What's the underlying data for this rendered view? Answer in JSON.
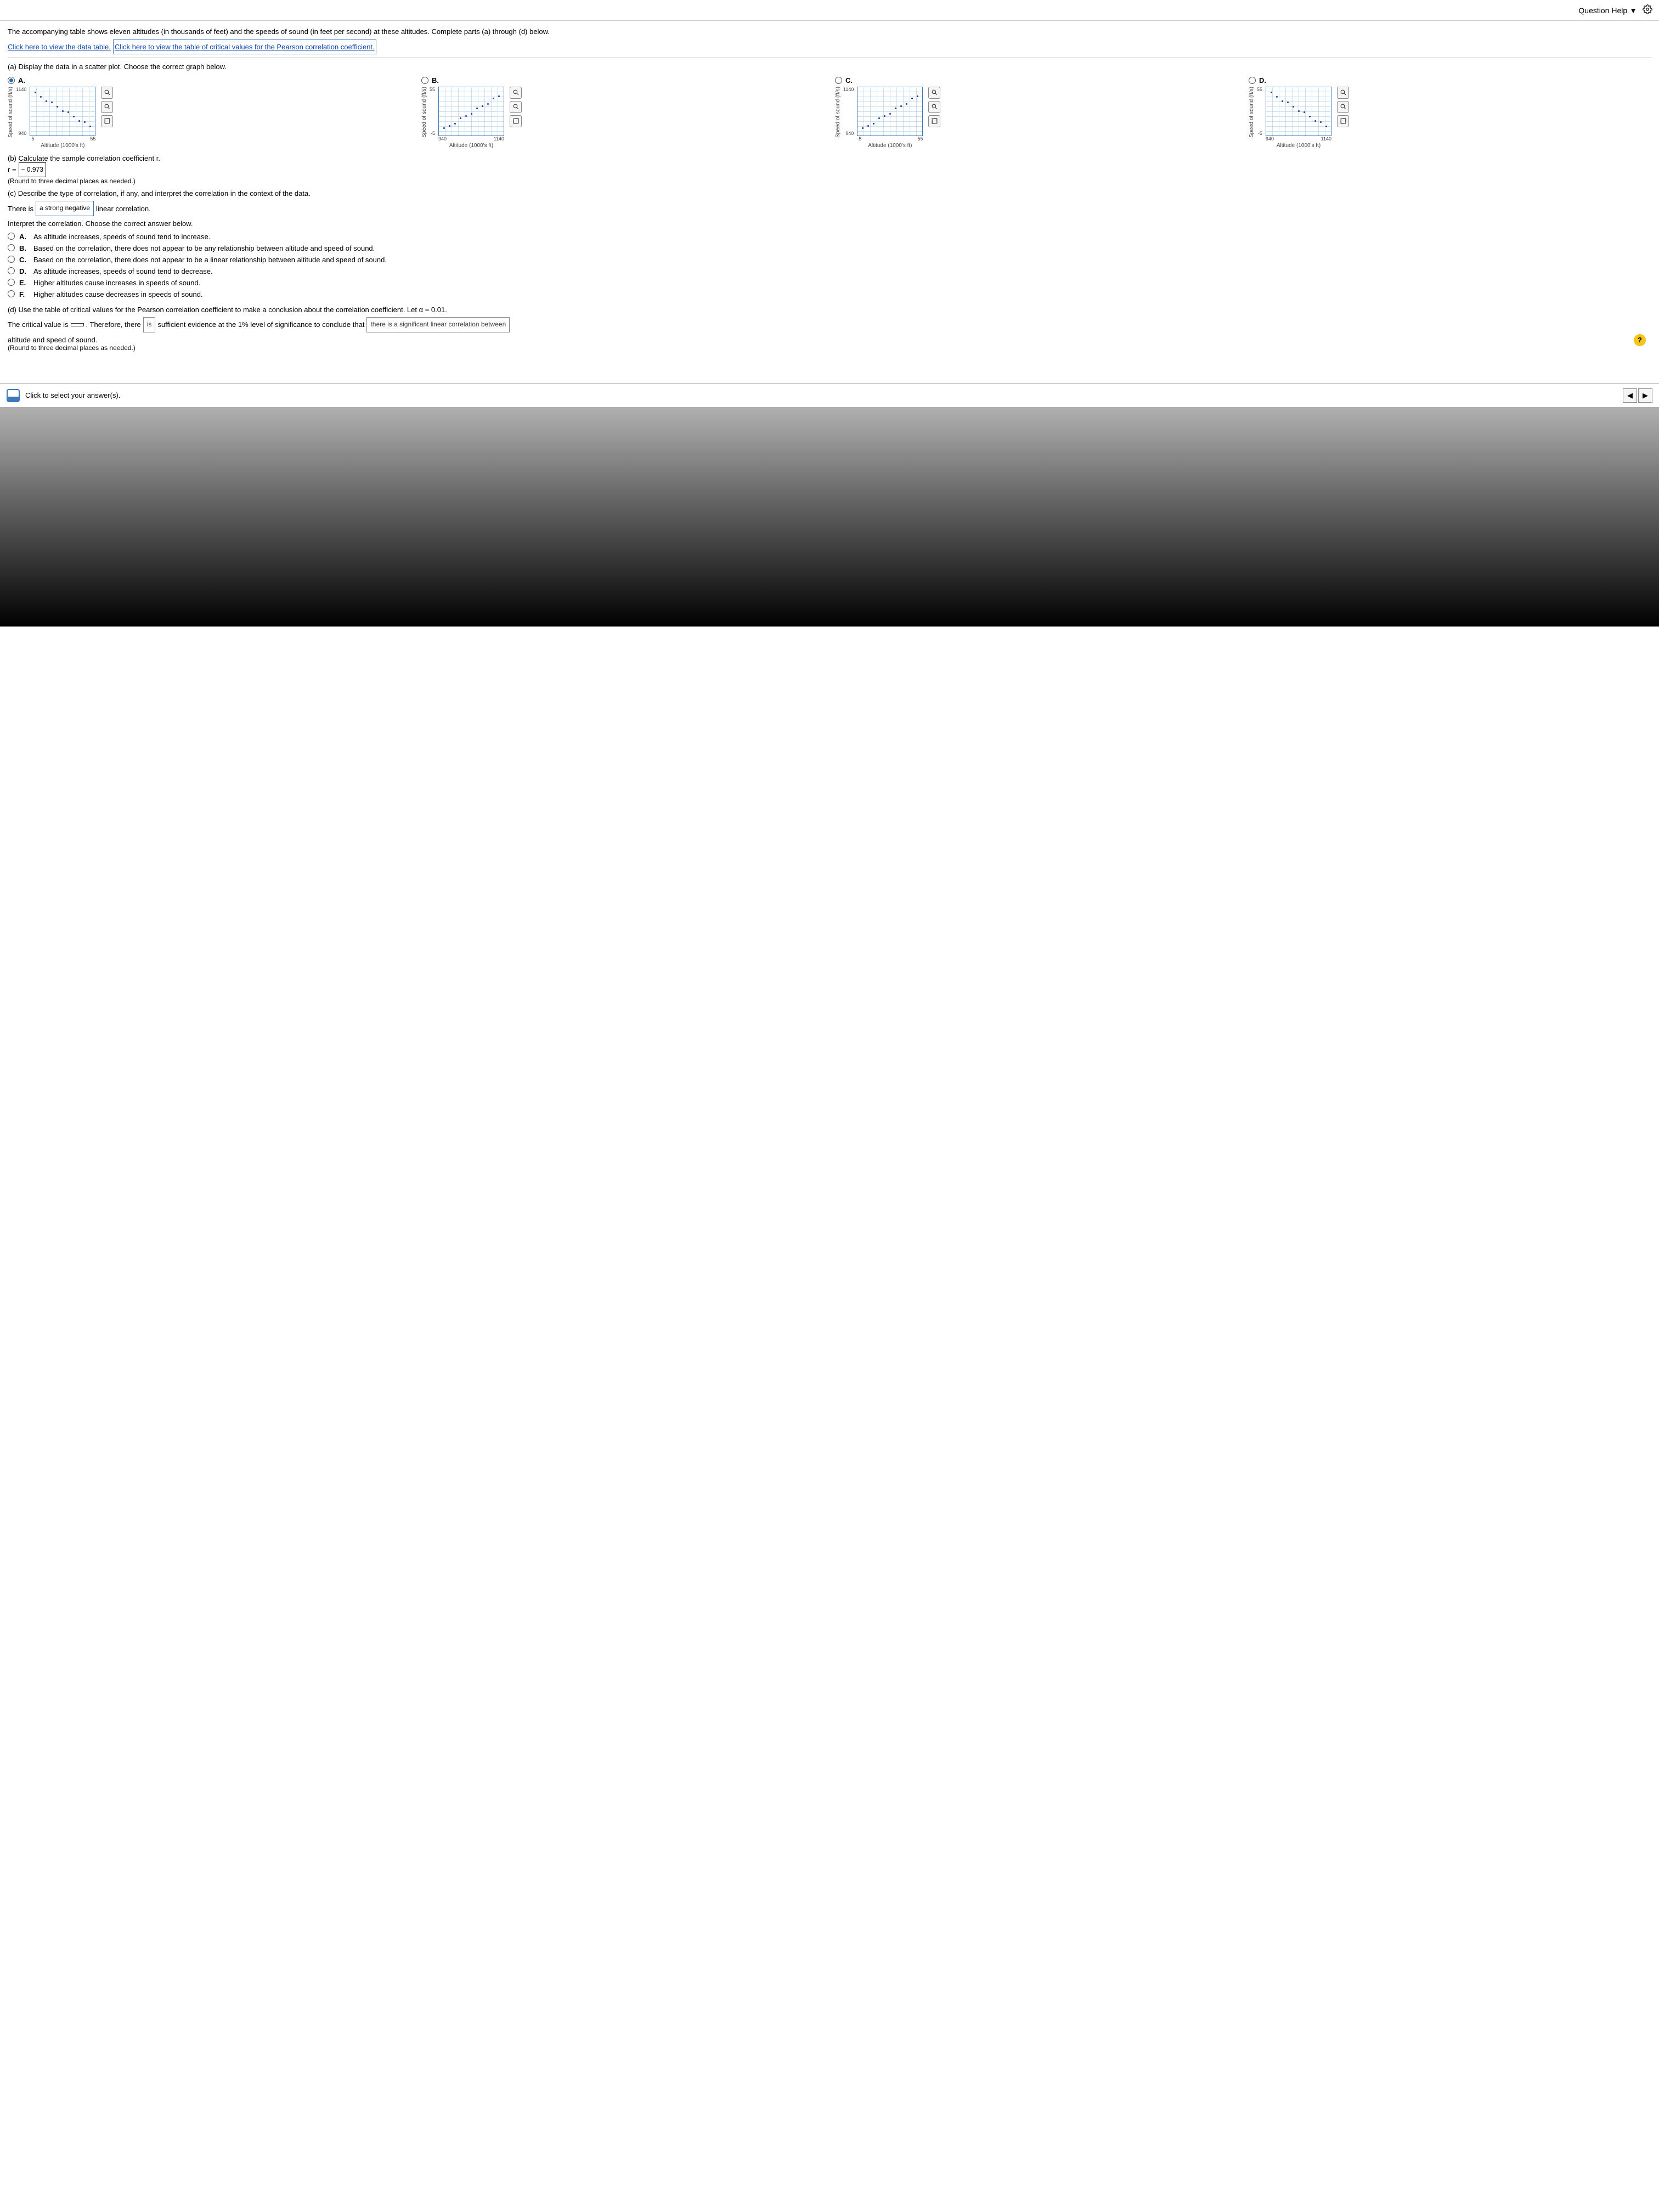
{
  "header": {
    "help_label": "Question Help",
    "dropdown_icon": "▼"
  },
  "intro": {
    "text": "The accompanying table shows eleven altitudes (in thousands of feet) and the speeds of sound (in feet per second) at these altitudes. Complete parts (a) through (d) below.",
    "link1": "Click here to view the data table.",
    "link2": "Click here to view the table of critical values for the Pearson correlation coefficient."
  },
  "part_a": {
    "prompt": "(a) Display the data in a scatter plot. Choose the correct graph below.",
    "selected": "A",
    "options": [
      {
        "letter": "A.",
        "ymin": "940",
        "ymax": "1140",
        "xmin": "-5",
        "xmax": "55",
        "ylabel": "Speed of sound (ft/s)",
        "xlabel": "Altitude (1000's ft)",
        "trend": "down"
      },
      {
        "letter": "B.",
        "ymin": "-5",
        "ymax": "55",
        "xmin": "940",
        "xmax": "1140",
        "ylabel": "Speed of sound (ft/s)",
        "xlabel": "Altitude (1000's ft)",
        "trend": "up"
      },
      {
        "letter": "C.",
        "ymin": "940",
        "ymax": "1140",
        "xmin": "-5",
        "xmax": "55",
        "ylabel": "Speed of sound (ft/s)",
        "xlabel": "Altitude (1000's ft)",
        "trend": "up"
      },
      {
        "letter": "D.",
        "ymin": "-5",
        "ymax": "55",
        "xmin": "940",
        "xmax": "1140",
        "ylabel": "Speed of sound (ft/s)",
        "xlabel": "Altitude (1000's ft)",
        "trend": "down"
      }
    ]
  },
  "part_b": {
    "prompt": "(b) Calculate the sample correlation coefficient r.",
    "r_prefix": "r =",
    "r_value": "− 0.973",
    "round_note": "(Round to three decimal places as needed.)"
  },
  "part_c": {
    "prompt": "(c) Describe the type of correlation, if any, and interpret the correlation in the context of the data.",
    "sentence_prefix": "There is",
    "dropdown_value": "a strong negative",
    "sentence_suffix": "linear correlation.",
    "interpret_prompt": "Interpret the correlation. Choose the correct answer below.",
    "choices": [
      {
        "letter": "A.",
        "text": "As altitude increases, speeds of sound tend to increase."
      },
      {
        "letter": "B.",
        "text": "Based on the correlation, there does not appear to be any relationship between altitude and speed of sound."
      },
      {
        "letter": "C.",
        "text": "Based on the correlation, there does not appear to be a linear relationship between altitude and speed of sound."
      },
      {
        "letter": "D.",
        "text": "As altitude increases, speeds of sound tend to decrease."
      },
      {
        "letter": "E.",
        "text": "Higher altitudes cause increases in speeds of sound."
      },
      {
        "letter": "F.",
        "text": "Higher altitudes cause decreases in speeds of sound."
      }
    ]
  },
  "part_d": {
    "prompt": "(d) Use the table of critical values for the Pearson correlation coefficient to make a conclusion about the correlation coefficient. Let α = 0.01.",
    "s1": "The critical value is",
    "input_value": "",
    "s2": ". Therefore, there",
    "dd1": "is",
    "s3": "sufficient evidence at the 1% level of significance to conclude that",
    "dd2": "there is a significant linear correlation between",
    "s4": "altitude and speed of sound.",
    "round_note": "(Round to three decimal places as needed.)"
  },
  "footer": {
    "prompt": "Click to select your answer(s).",
    "help_badge": "?"
  }
}
